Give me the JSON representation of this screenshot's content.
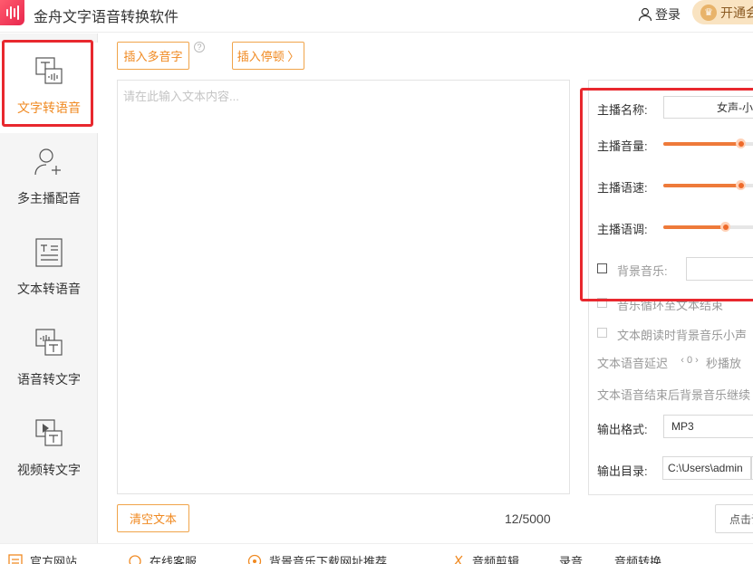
{
  "app": {
    "title": "金舟文字语音转换软件"
  },
  "header": {
    "login_label": "登录",
    "vip_label": "开通会员"
  },
  "sidebar": {
    "items": [
      {
        "label": "文字转语音",
        "icon": "text-to-speech-icon",
        "active": true
      },
      {
        "label": "多主播配音",
        "icon": "multi-voice-icon",
        "active": false
      },
      {
        "label": "文本转语音",
        "icon": "document-to-speech-icon",
        "active": false
      },
      {
        "label": "语音转文字",
        "icon": "speech-to-text-icon",
        "active": false
      },
      {
        "label": "视频转文字",
        "icon": "video-to-text-icon",
        "active": false
      }
    ]
  },
  "editor": {
    "insert_polyphone_label": "插入多音字",
    "insert_pause_label": "插入停顿 〉",
    "help_symbol": "?",
    "placeholder": "请在此输入文本内容...",
    "clear_label": "清空文本",
    "counter": "12/5000"
  },
  "settings": {
    "voice_name_label": "主播名称:",
    "voice_name_value": "女声-小",
    "volume_label": "主播音量:",
    "volume_level": 0.77,
    "speed_label": "主播语速:",
    "speed_level": 0.77,
    "pitch_label": "主播语调:",
    "pitch_level": 0.62,
    "bgm_label": "背景音乐:",
    "loop_label": "音乐循环至文本结束",
    "lower_bgm_label": "文本朗读时背景音乐小声",
    "delay_prefix": "文本语音延迟",
    "delay_value": "‹ 0 ›",
    "delay_suffix": "秒播放",
    "after_end_label": "文本语音结束后背景音乐继续",
    "format_label": "输出格式:",
    "format_value": "MP3",
    "dir_label": "输出目录:",
    "dir_value": "C:\\Users\\admin",
    "convert_label": "点击试听"
  },
  "footer": {
    "items": [
      {
        "label": "官方网站",
        "icon": "website-icon"
      },
      {
        "label": "在线客服",
        "icon": "customer-service-icon"
      },
      {
        "label": "背景音乐下载网址推荐",
        "icon": "music-download-icon"
      },
      {
        "label": "音频剪辑",
        "icon": "audio-clip-icon"
      },
      {
        "label": "录音",
        "icon": "record-icon"
      },
      {
        "label": "音频转换",
        "icon": "audio-convert-icon"
      }
    ]
  },
  "colors": {
    "accent": "#f08a22",
    "highlight_box": "#e8282e",
    "slider_fill": "#ee7a3a"
  }
}
